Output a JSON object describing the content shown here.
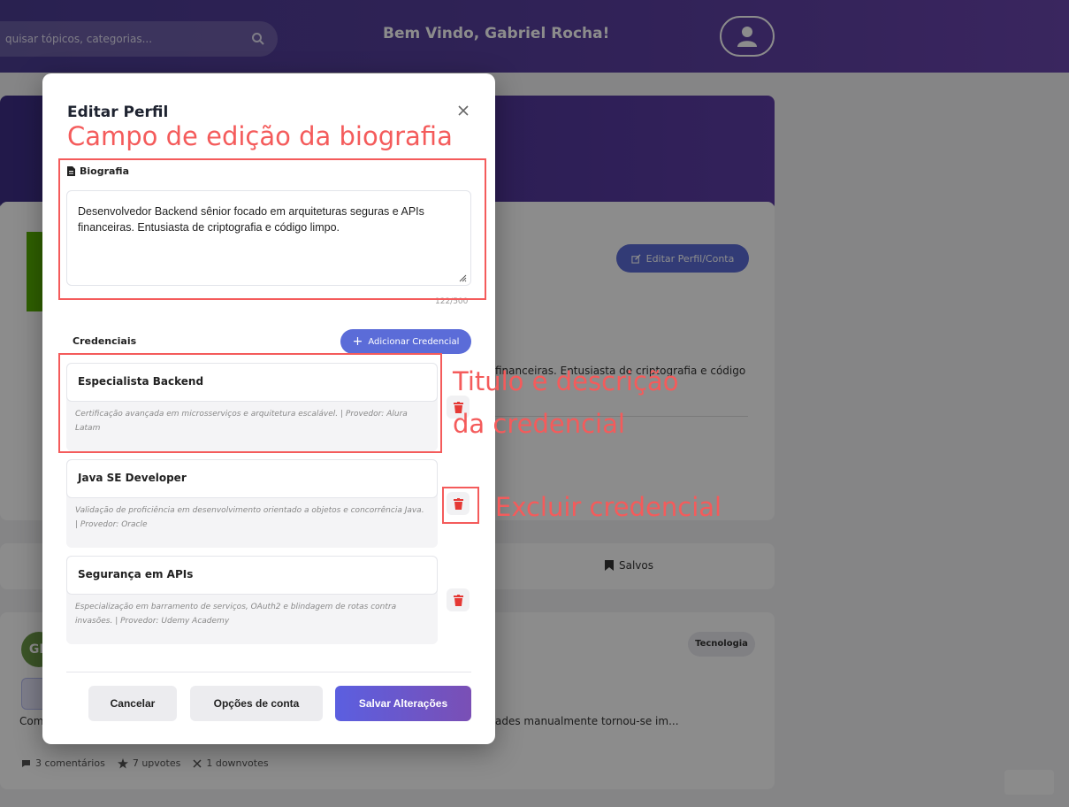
{
  "header": {
    "search_placeholder": "quisar tópicos, categorias...",
    "welcome": "Bem Vindo, Gabriel Rocha!"
  },
  "background": {
    "edit_profile_button": "Editar Perfil/Conta",
    "bio_excerpt": "financeiras. Entusiasta de criptografia e código",
    "tab_saved": "Salvos",
    "post": {
      "avatar_initials": "GR",
      "tag": "Tecnologia",
      "excerpt_left": "Com",
      "excerpt_right": "ades manualmente tornou-se im...",
      "comments": "3 comentários",
      "upvotes": "7 upvotes",
      "downvotes": "1 downvotes"
    }
  },
  "modal": {
    "title": "Editar Perfil",
    "bio_label": "Biografia",
    "bio_text": "Desenvolvedor Backend sênior focado em arquiteturas seguras e APIs financeiras. Entusiasta de criptografia e código limpo.",
    "char_count": "122/500",
    "credentials_title": "Credenciais",
    "add_credential": "Adicionar Credencial",
    "credentials": [
      {
        "name": "Especialista Backend",
        "description": "Certificação avançada em microsserviços e arquitetura escalável. | Provedor: Alura Latam"
      },
      {
        "name": "Java SE Developer",
        "description": "Validação de proficiência em desenvolvimento orientado a objetos e concorrência Java. | Provedor: Oracle"
      },
      {
        "name": "Segurança em APIs",
        "description": "Especialização em barramento de serviços, OAuth2 e blindagem de rotas contra invasões. | Provedor: Udemy Academy"
      }
    ],
    "buttons": {
      "cancel": "Cancelar",
      "account_options": "Opções de conta",
      "save": "Salvar Alterações"
    }
  },
  "annotations": {
    "bio_field": "Campo de edição da biografia",
    "credential_title_line1": "Titulo e descrição",
    "credential_title_line2": "da credencial",
    "delete_credential": "Excluir credencial"
  },
  "colors": {
    "accent": "#5b6cd8",
    "header": "#4b3c93",
    "annotation": "#f45b5b",
    "danger": "#e53935"
  }
}
